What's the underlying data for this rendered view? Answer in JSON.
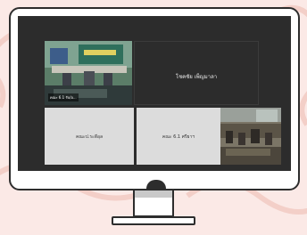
{
  "meeting": {
    "tiles": [
      {
        "caption": "คณะ 6.1 รับ/อ..."
      },
      {
        "label": "โชคชัย เพ็ญมาลา"
      },
      {
        "label": "คณะป.ระดีอุล"
      },
      {
        "label": "คณะ 6.1 ศรียาฯ"
      },
      {
        "caption": ""
      }
    ]
  },
  "colors": {
    "background": "#fbe9e6",
    "monitor_frame": "#2d2d2d",
    "screen": "#2c2c2c",
    "gray_tile": "#dcdcdc"
  }
}
